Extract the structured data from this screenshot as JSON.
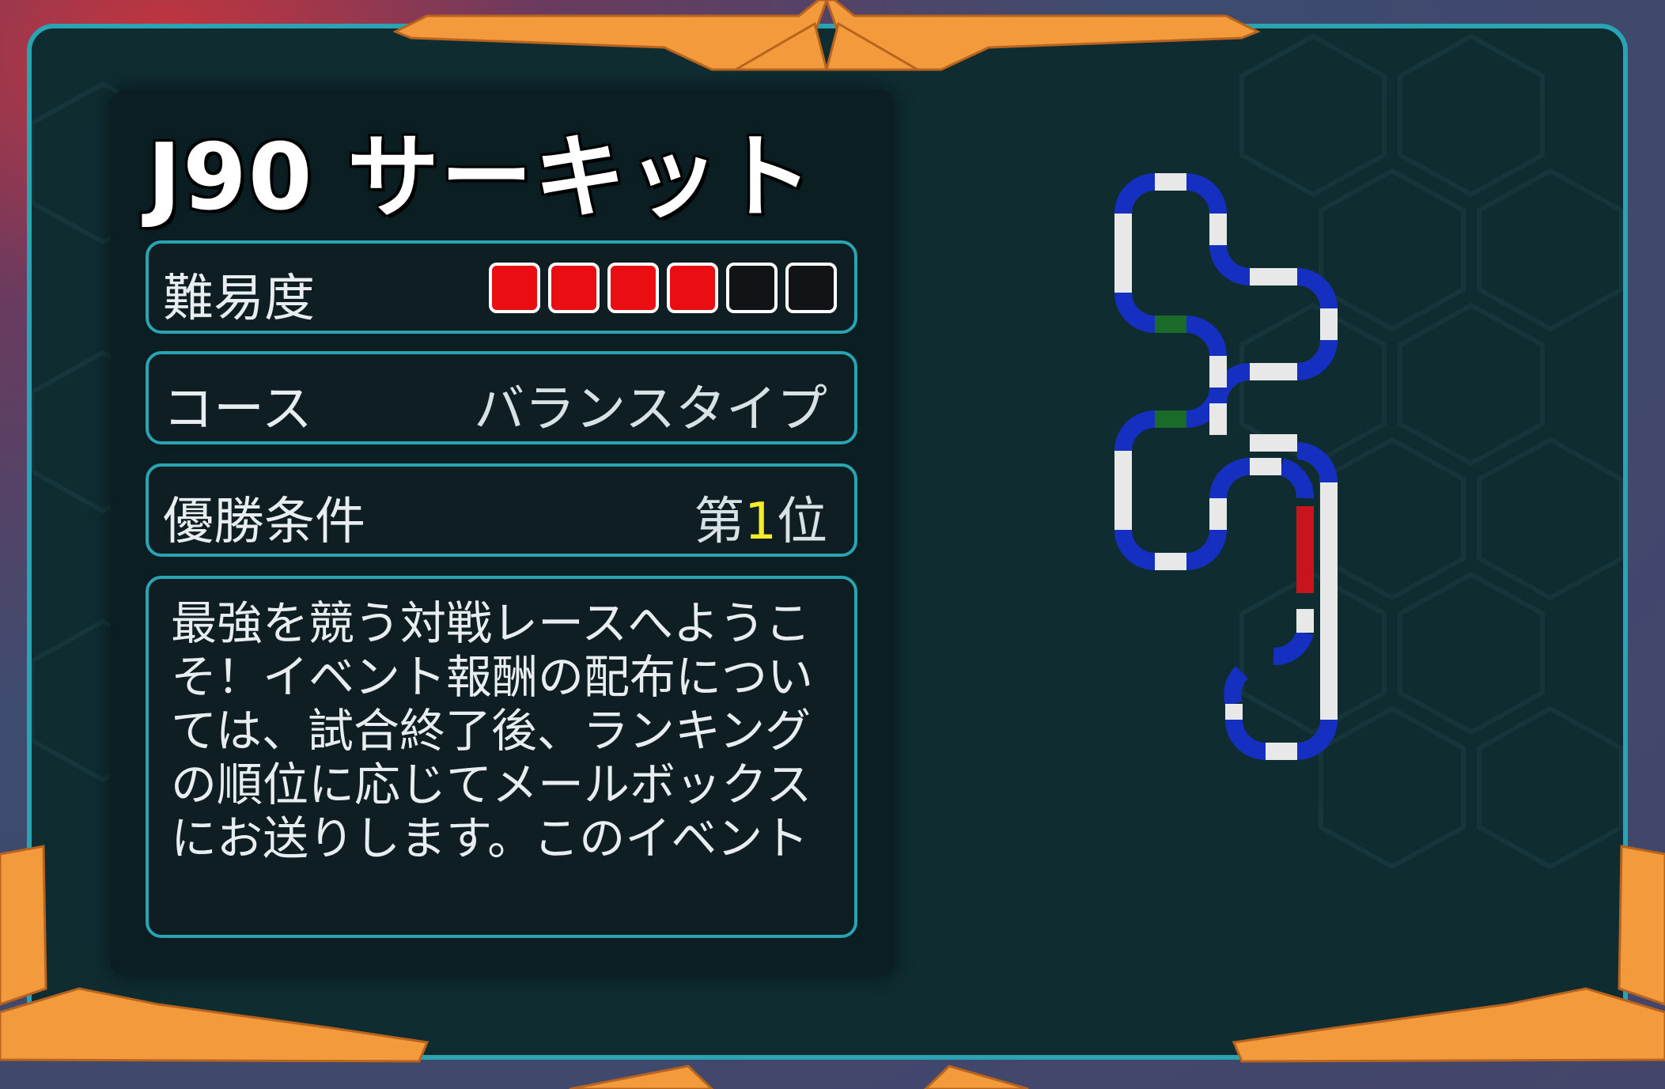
{
  "event": {
    "title": "J90 サーキット",
    "difficulty_label": "難易度",
    "difficulty_level": 4,
    "difficulty_max": 6,
    "course_label": "コース",
    "course_value": "バランスタイプ",
    "win_label": "優勝条件",
    "win_prefix": "第",
    "win_number": "1",
    "win_suffix": "位",
    "description": "最強を競う対戦レースへようこそ！イベント報酬の配布については、試合終了後、ランキングの順位に応じてメールボックスにお送りします。このイベント"
  },
  "colors": {
    "frame_border": "#2aa3b3",
    "ornament": "#f39a3c",
    "pip_on": "#ea0e12",
    "highlight": "#f4ec2a",
    "track_curve": "#1530c0",
    "track_straight": "#e8e8e8",
    "track_red": "#c8141c",
    "track_green": "#1a6a2a"
  }
}
